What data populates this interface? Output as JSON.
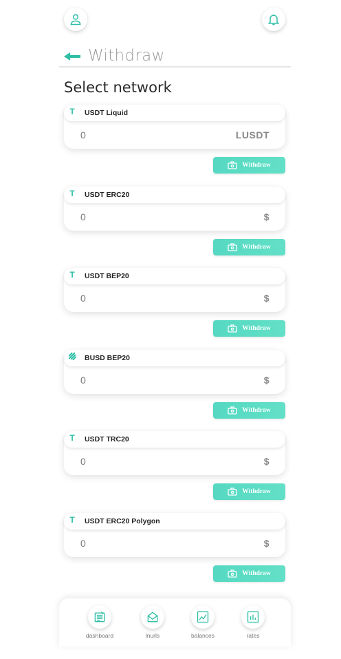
{
  "header": {
    "title": "Withdraw"
  },
  "section_title": "Select network",
  "networks": [
    {
      "name": "USDT Liquid",
      "amount": "0",
      "unit": "LUSDT",
      "icon": "tether-icon",
      "withdraw_label": "Withdraw"
    },
    {
      "name": "USDT ERC20",
      "amount": "0",
      "unit": "$",
      "icon": "tether-icon",
      "withdraw_label": "Withdraw"
    },
    {
      "name": "USDT BEP20",
      "amount": "0",
      "unit": "$",
      "icon": "tether-icon",
      "withdraw_label": "Withdraw"
    },
    {
      "name": "BUSD BEP20",
      "amount": "0",
      "unit": "$",
      "icon": "busd-icon",
      "withdraw_label": "Withdraw"
    },
    {
      "name": "USDT TRC20",
      "amount": "0",
      "unit": "$",
      "icon": "tether-icon",
      "withdraw_label": "Withdraw"
    },
    {
      "name": "USDT ERC20 Polygon",
      "amount": "0",
      "unit": "$",
      "icon": "tether-icon",
      "withdraw_label": "Withdraw"
    }
  ],
  "bottom_nav": [
    {
      "label": "dashboard",
      "icon": "dashboard-icon"
    },
    {
      "label": "lnurls",
      "icon": "lnurls-icon"
    },
    {
      "label": "balances",
      "icon": "balances-icon"
    },
    {
      "label": "rates",
      "icon": "rates-icon"
    }
  ],
  "colors": {
    "accent": "#2fbfa6",
    "button": "#5bdcc4"
  }
}
